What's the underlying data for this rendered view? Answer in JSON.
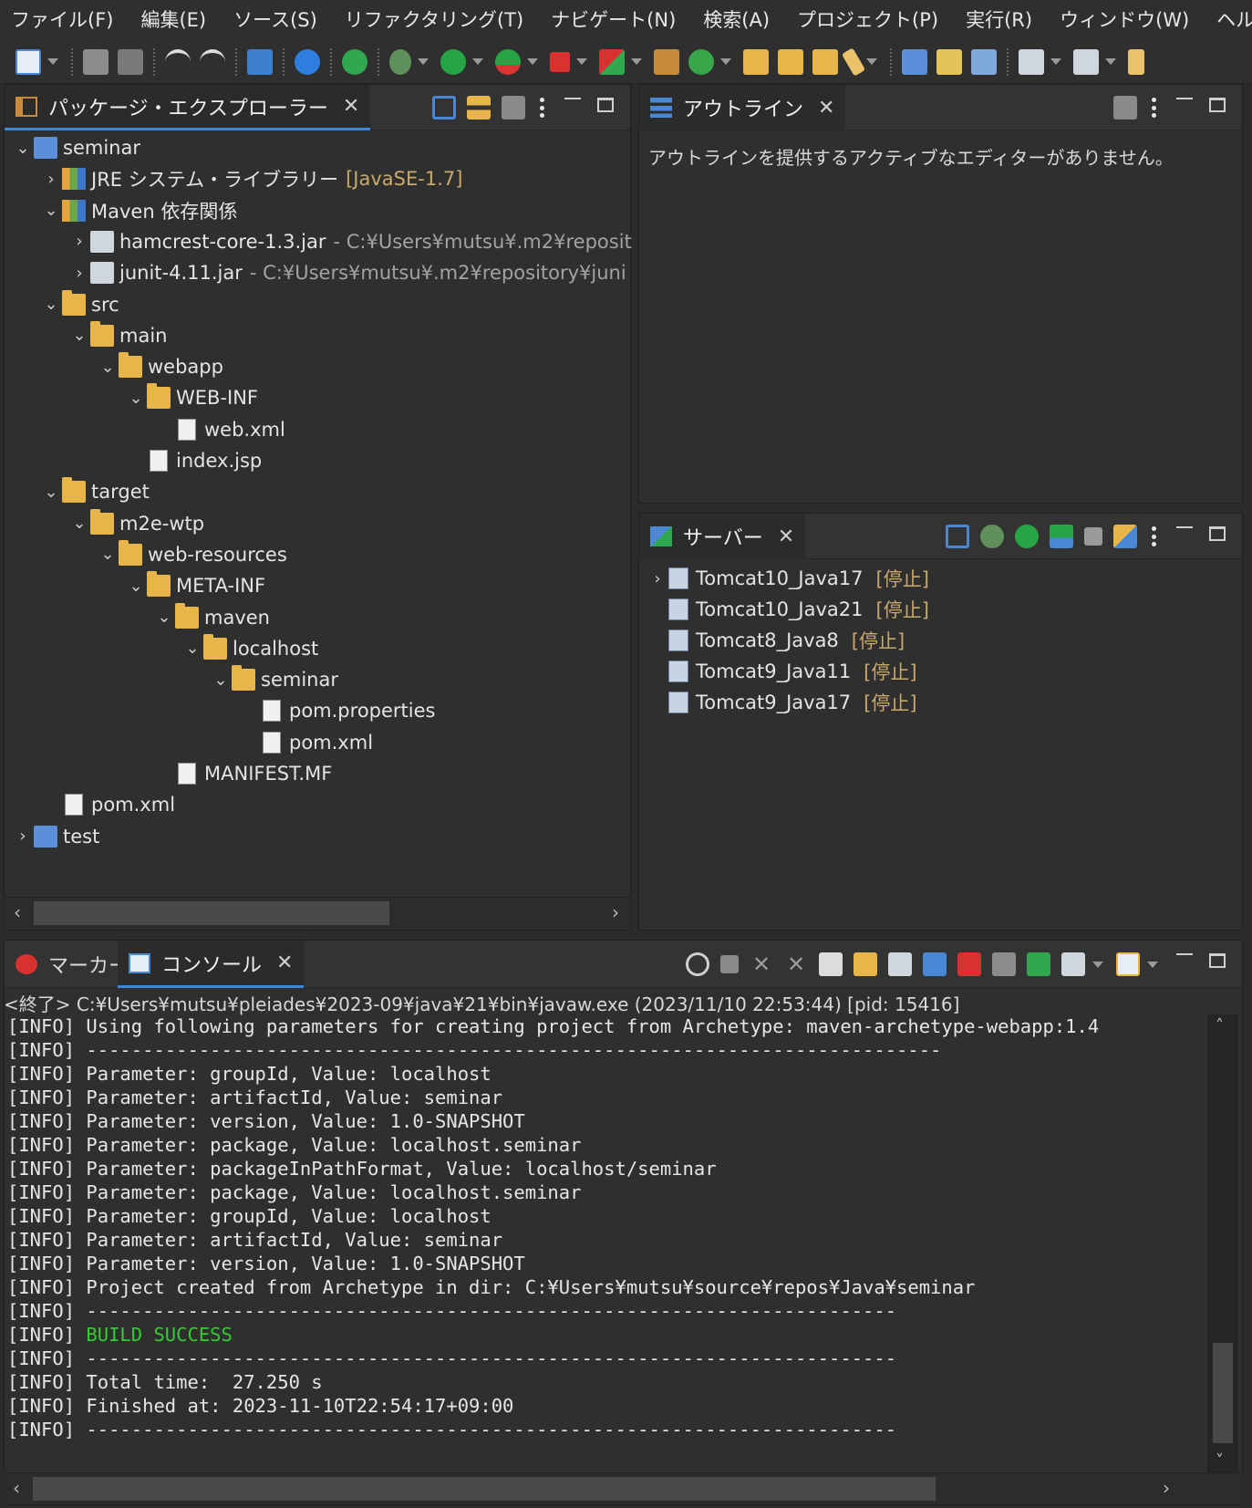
{
  "menu": [
    "ファイル(F)",
    "編集(E)",
    "ソース(S)",
    "リファクタリング(T)",
    "ナビゲート(N)",
    "検索(A)",
    "プロジェクト(P)",
    "実行(R)",
    "ウィンドウ(W)",
    "ヘルプ(H)"
  ],
  "explorer": {
    "tab_label": "パッケージ・エクスプローラー",
    "tree": [
      {
        "label": "seminar",
        "suffix": "",
        "arrow": "v"
      },
      {
        "label": "JRE システム・ライブラリー",
        "suffix": "[JavaSE-1.7]",
        "arrow": ">"
      },
      {
        "label": "Maven 依存関係",
        "suffix": "",
        "arrow": "v"
      },
      {
        "label": "hamcrest-core-1.3.jar",
        "suffix": "- C:¥Users¥mutsu¥.m2¥reposit",
        "arrow": ">"
      },
      {
        "label": "junit-4.11.jar",
        "suffix": "- C:¥Users¥mutsu¥.m2¥repository¥juni",
        "arrow": ">"
      },
      {
        "label": "src",
        "suffix": "",
        "arrow": "v"
      },
      {
        "label": "main",
        "suffix": "",
        "arrow": "v"
      },
      {
        "label": "webapp",
        "suffix": "",
        "arrow": "v"
      },
      {
        "label": "WEB-INF",
        "suffix": "",
        "arrow": "v"
      },
      {
        "label": "web.xml",
        "suffix": "",
        "arrow": ""
      },
      {
        "label": "index.jsp",
        "suffix": "",
        "arrow": ""
      },
      {
        "label": "target",
        "suffix": "",
        "arrow": "v"
      },
      {
        "label": "m2e-wtp",
        "suffix": "",
        "arrow": "v"
      },
      {
        "label": "web-resources",
        "suffix": "",
        "arrow": "v"
      },
      {
        "label": "META-INF",
        "suffix": "",
        "arrow": "v"
      },
      {
        "label": "maven",
        "suffix": "",
        "arrow": "v"
      },
      {
        "label": "localhost",
        "suffix": "",
        "arrow": "v"
      },
      {
        "label": "seminar",
        "suffix": "",
        "arrow": "v"
      },
      {
        "label": "pom.properties",
        "suffix": "",
        "arrow": ""
      },
      {
        "label": "pom.xml",
        "suffix": "",
        "arrow": ""
      },
      {
        "label": "MANIFEST.MF",
        "suffix": "",
        "arrow": ""
      },
      {
        "label": "pom.xml",
        "suffix": "",
        "arrow": ""
      },
      {
        "label": "test",
        "suffix": "",
        "arrow": ">"
      }
    ]
  },
  "outline": {
    "tab_label": "アウトライン",
    "message": "アウトラインを提供するアクティブなエディターがありません。"
  },
  "servers": {
    "tab_label": "サーバー",
    "items": [
      {
        "name": "Tomcat10_Java17",
        "status": "[停止]"
      },
      {
        "name": "Tomcat10_Java21",
        "status": "[停止]"
      },
      {
        "name": "Tomcat8_Java8",
        "status": "[停止]"
      },
      {
        "name": "Tomcat9_Java11",
        "status": "[停止]"
      },
      {
        "name": "Tomcat9_Java17",
        "status": "[停止]"
      }
    ]
  },
  "bottom": {
    "markers_tab": "マーカー",
    "console_tab": "コンソール",
    "header": "<終了> C:¥Users¥mutsu¥pleiades¥2023-09¥java¥21¥bin¥javaw.exe (2023/11/10 22:53:44) [pid: 15416]",
    "lines": [
      {
        "prefix": "[INFO] ",
        "text": "Using following parameters for creating project from Archetype: maven-archetype-webapp:1.4",
        "success": false
      },
      {
        "prefix": "[INFO] ",
        "text": "----------------------------------------------------------------------------",
        "success": false
      },
      {
        "prefix": "[INFO] ",
        "text": "Parameter: groupId, Value: localhost",
        "success": false
      },
      {
        "prefix": "[INFO] ",
        "text": "Parameter: artifactId, Value: seminar",
        "success": false
      },
      {
        "prefix": "[INFO] ",
        "text": "Parameter: version, Value: 1.0-SNAPSHOT",
        "success": false
      },
      {
        "prefix": "[INFO] ",
        "text": "Parameter: package, Value: localhost.seminar",
        "success": false
      },
      {
        "prefix": "[INFO] ",
        "text": "Parameter: packageInPathFormat, Value: localhost/seminar",
        "success": false
      },
      {
        "prefix": "[INFO] ",
        "text": "Parameter: package, Value: localhost.seminar",
        "success": false
      },
      {
        "prefix": "[INFO] ",
        "text": "Parameter: groupId, Value: localhost",
        "success": false
      },
      {
        "prefix": "[INFO] ",
        "text": "Parameter: artifactId, Value: seminar",
        "success": false
      },
      {
        "prefix": "[INFO] ",
        "text": "Parameter: version, Value: 1.0-SNAPSHOT",
        "success": false
      },
      {
        "prefix": "[INFO] ",
        "text": "Project created from Archetype in dir: C:¥Users¥mutsu¥source¥repos¥Java¥seminar",
        "success": false
      },
      {
        "prefix": "[INFO] ",
        "text": "------------------------------------------------------------------------",
        "success": false
      },
      {
        "prefix": "[INFO] ",
        "text": "BUILD SUCCESS",
        "success": true
      },
      {
        "prefix": "[INFO] ",
        "text": "------------------------------------------------------------------------",
        "success": false
      },
      {
        "prefix": "[INFO] ",
        "text": "Total time:  27.250 s",
        "success": false
      },
      {
        "prefix": "[INFO] ",
        "text": "Finished at: 2023-11-10T22:54:17+09:00",
        "success": false
      },
      {
        "prefix": "[INFO] ",
        "text": "------------------------------------------------------------------------",
        "success": false
      }
    ]
  },
  "colors": {
    "accent": "#3d87d6",
    "success": "#33cc33",
    "folder": "#e8b54a",
    "status": "#c9a86b"
  }
}
